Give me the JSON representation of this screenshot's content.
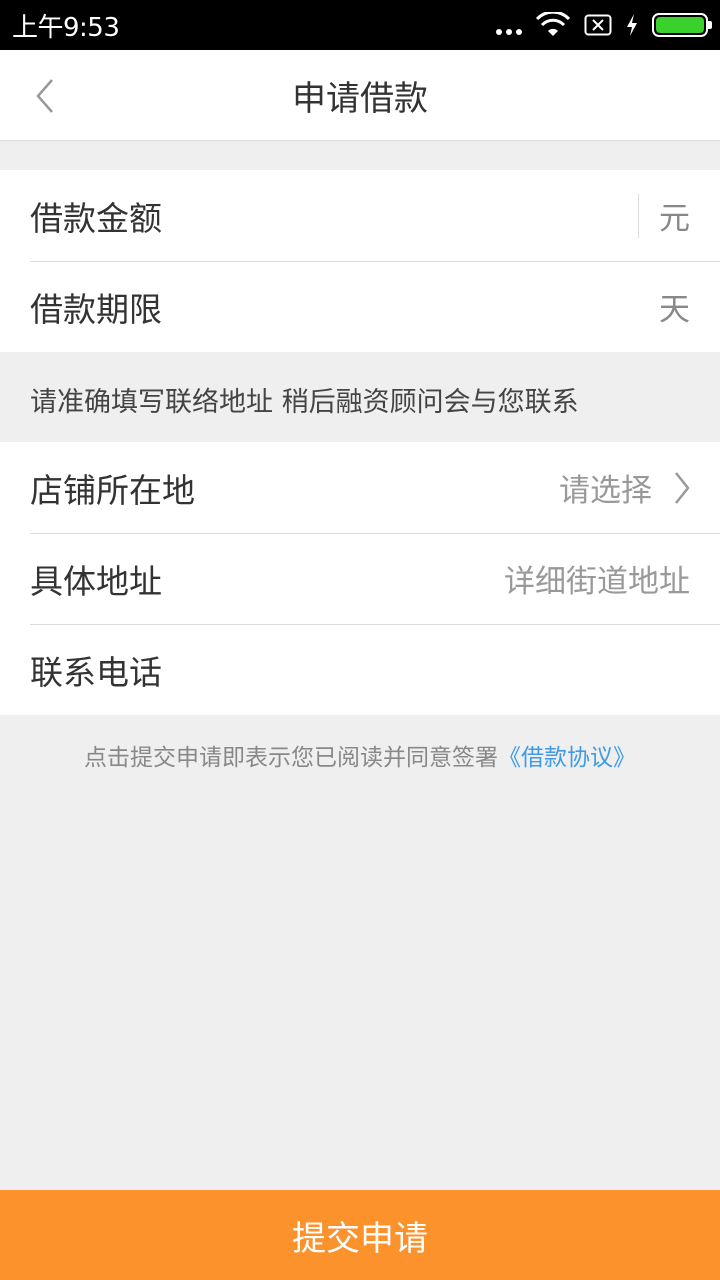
{
  "status_bar": {
    "time": "上午9:53"
  },
  "nav": {
    "title": "申请借款"
  },
  "loan": {
    "amount_label": "借款金额",
    "amount_unit": "元",
    "term_label": "借款期限",
    "term_unit": "天"
  },
  "hint": "请准确填写联络地址 稍后融资顾问会与您联系",
  "address": {
    "store_label": "店铺所在地",
    "store_value": "请选择",
    "detail_label": "具体地址",
    "detail_placeholder": "详细街道地址",
    "phone_label": "联系电话"
  },
  "agreement": {
    "text": "点击提交申请即表示您已阅读并同意签署",
    "link": "《借款协议》"
  },
  "submit_label": "提交申请",
  "colors": {
    "accent": "#fb922b",
    "link": "#3f9be6",
    "background": "#efefef"
  }
}
